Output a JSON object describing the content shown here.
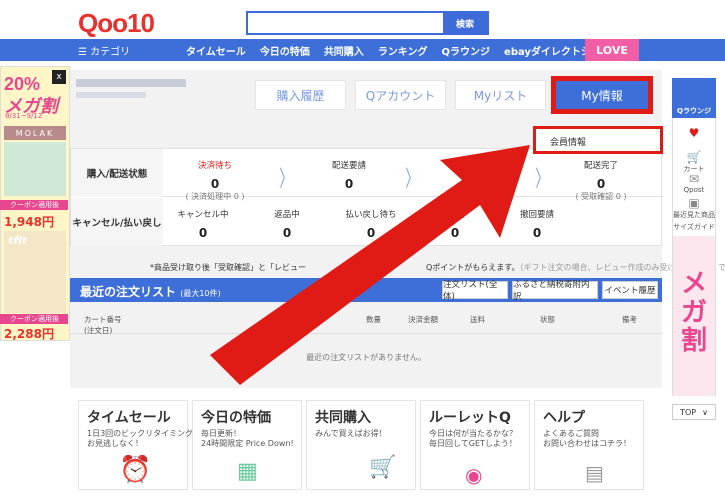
{
  "header": {
    "logo": "Qoo10",
    "search_placeholder": "",
    "search_button": "検索"
  },
  "nav": {
    "category": "☰ カテゴリ",
    "items": [
      "タイムセール",
      "今日の特価",
      "共同購入",
      "ランキング",
      "Qラウンジ",
      "ebayダイレクトショップ"
    ],
    "love": "LOVE"
  },
  "tabs": [
    "購入履歴",
    "Qアカウント",
    "Myリスト",
    "My情報"
  ],
  "submenu": "会員情報",
  "status": {
    "row1_head": "購入/配送状態",
    "row1": [
      {
        "label": "決済待ち",
        "num": "0",
        "sub": "( 決済処理中 0 )",
        "red": true
      },
      {
        "label": "配送要請",
        "num": "0",
        "sub": ""
      },
      {
        "label": "配送完了",
        "num": "0",
        "sub": "( 受取確認 0 )"
      }
    ],
    "row2_head": "キャンセル/払い戻し",
    "row2": [
      {
        "label": "キャンセル中",
        "num": "0"
      },
      {
        "label": "返品中",
        "num": "0"
      },
      {
        "label": "払い戻し待ち",
        "num": "0"
      },
      {
        "label": "し完了",
        "num": "0"
      },
      {
        "label": "撤回要請",
        "num": "0"
      }
    ]
  },
  "notice": {
    "text": "*商品受け取り後「受取確認」と「レビュー",
    "text2": "Qポイントがもらえます。",
    "grey": "（ギフト注文の場合、レビュー作成のみ受け取りが可能 です。）"
  },
  "orders": {
    "title": "最近の注文リスト",
    "title_small": "(最大10件)",
    "buttons": [
      "注文リスト(全体)",
      "ふるさと納税寄附内訳",
      "イベント履歴"
    ],
    "columns": [
      "カート番号\n(注文日)",
      "数量",
      "決済金額",
      "送料",
      "状態",
      "備考"
    ],
    "empty": "最近の注文リストがありません。"
  },
  "features": [
    {
      "title": "タイムセール",
      "sub": "1日3回のビックリタイミング!\nお見逃しなく！"
    },
    {
      "title": "今日の特価",
      "sub": "毎日更新！\n24時間限定 Price Down!"
    },
    {
      "title": "共同購入",
      "sub": "みんで買えばお得！"
    },
    {
      "title": "ルーレットQ",
      "sub": "今日は何が当たるかな？\n毎日回してGETしよう！"
    },
    {
      "title": "ヘルプ",
      "sub": "よくあるご質問\nお問い合わせはコチラ！"
    }
  ],
  "left_ad": {
    "close": "x",
    "pct": "20%",
    "mega": "メガ割",
    "date": "8/31~9/12",
    "brand": "MOLAK",
    "coupon": "クーポン適用後",
    "price": "1,948円",
    "brand2": "tfit",
    "coupon2": "クーポン適用後",
    "price2": "2,288円"
  },
  "right_bar": {
    "qrounge": "Qラウンジ",
    "cart": "カート",
    "qpost": "Qpost",
    "recent": "最近見た商品",
    "size": "サイズガイド",
    "mega": "メガ割",
    "top": "TOP"
  },
  "colors": {
    "brand_blue": "#3e6fd9",
    "highlight_red": "#e01a14",
    "pink": "#e8468e"
  }
}
